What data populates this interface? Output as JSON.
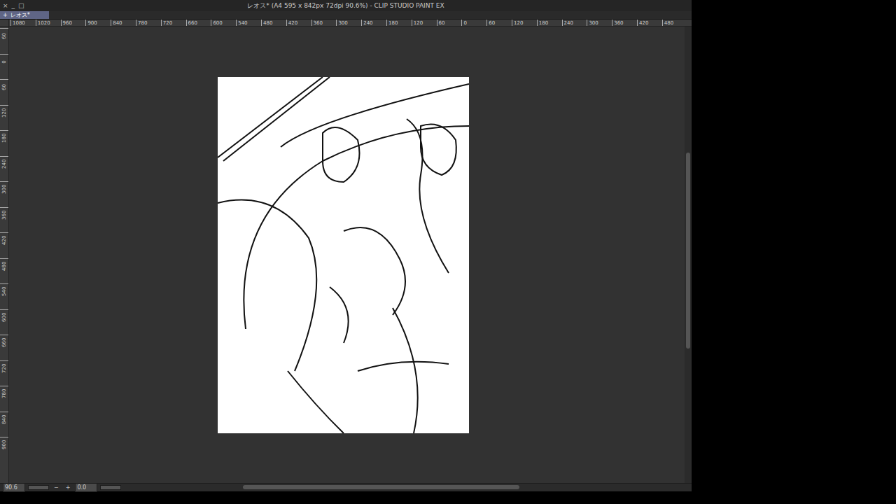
{
  "window": {
    "title": "レオス* (A4 595 x 842px 72dpi 90.6%)  - CLIP STUDIO PAINT EX",
    "controls": [
      "×",
      "_",
      "□"
    ]
  },
  "tabs": [
    {
      "label": "レオス*",
      "icon": "+",
      "selected": true
    }
  ],
  "ruler": {
    "horizontal": [
      "1080",
      "1020",
      "960",
      "900",
      "840",
      "780",
      "720",
      "660",
      "600",
      "540",
      "480",
      "420",
      "360",
      "300",
      "240",
      "180",
      "120",
      "60",
      "0",
      "60",
      "120",
      "180",
      "240",
      "300",
      "360",
      "420",
      "480"
    ],
    "vertical": [
      "60",
      "0",
      "60",
      "120",
      "180",
      "240",
      "300",
      "360",
      "420",
      "480",
      "540",
      "600",
      "660",
      "720",
      "780",
      "840",
      "900"
    ]
  },
  "status_bar": {
    "zoom": "90.6",
    "zoom_out": "−",
    "zoom_in": "+",
    "rotation": "0.0"
  }
}
